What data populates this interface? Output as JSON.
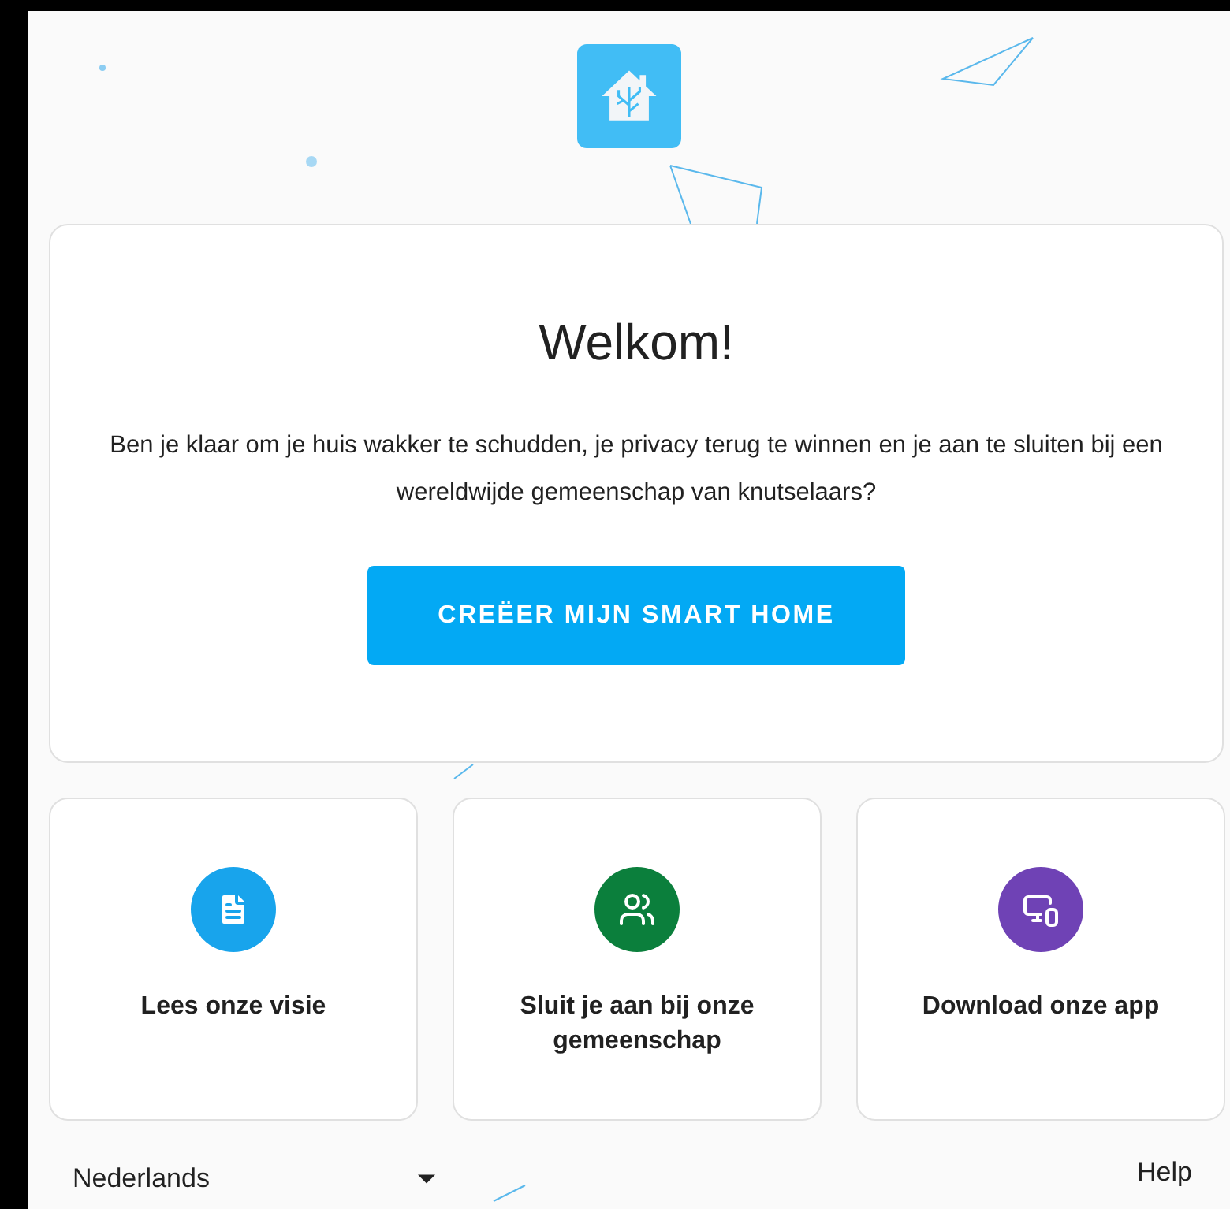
{
  "welcome": {
    "title": "Welkom!",
    "text": "Ben je klaar om je huis wakker te schudden, je privacy terug te winnen en je aan te sluiten bij een wereldwijde gemeenschap van knutselaars?",
    "button": "CREËER MIJN SMART HOME"
  },
  "links": [
    {
      "kind": "vision",
      "label": "Lees onze visie",
      "color": "#18a4ec"
    },
    {
      "kind": "community",
      "label": "Sluit je aan bij onze gemeenschap",
      "color": "#0b7f3c"
    },
    {
      "kind": "app",
      "label": "Download onze app",
      "color": "#6f42b5"
    }
  ],
  "footer": {
    "language": "Nederlands",
    "help": "Help"
  }
}
